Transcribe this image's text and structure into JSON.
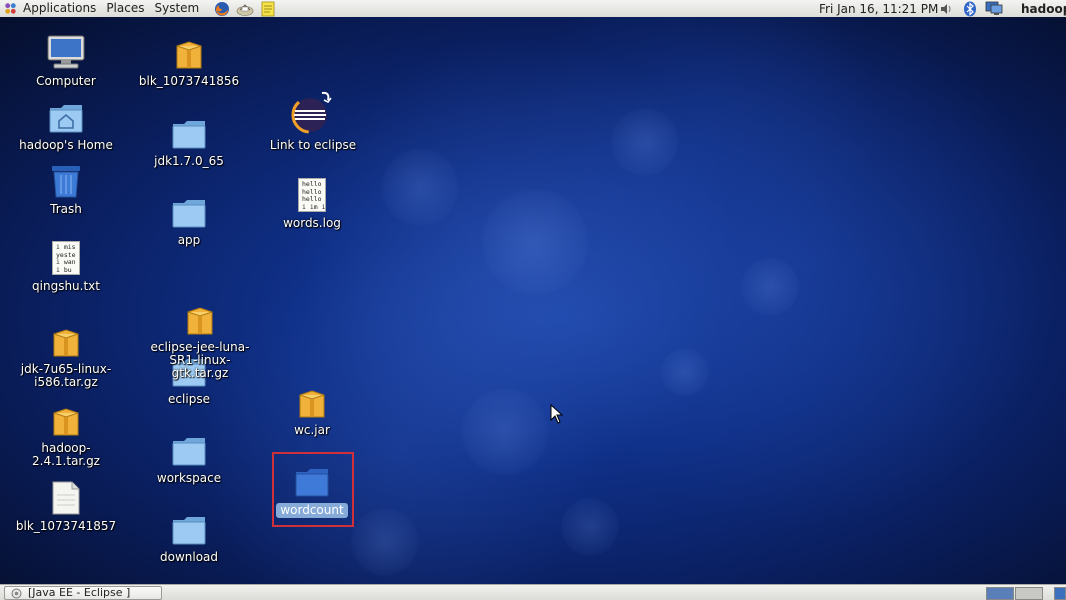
{
  "top_panel": {
    "menus": [
      "Applications",
      "Places",
      "System"
    ],
    "launchers": [
      "firefox-icon",
      "mail-client-icon",
      "notes-icon"
    ],
    "datetime": "Fri Jan 16, 11:21 PM",
    "username": "hadoop"
  },
  "desktop": {
    "icons": {
      "computer": "Computer",
      "home": "hadoop's Home",
      "trash": "Trash",
      "qingshu": "qingshu.txt",
      "qingshu_preview": "i mis\nyeste\ni wan\ni bu",
      "jdk_tar": "jdk-7u65-linux-i586.tar.gz",
      "hadoop_tar": "hadoop-2.4.1.tar.gz",
      "blk_857": "blk_1073741857",
      "blk_856": "blk_1073741856",
      "jdk_dir": "jdk1.7.0_65",
      "app": "app",
      "eclipse_tar": "eclipse-jee-luna-SR1-linux-gtk.tar.gz",
      "eclipse_dir": "eclipse",
      "workspace": "workspace",
      "download": "download",
      "eclipse_link": "Link to eclipse",
      "words_log": "words.log",
      "words_preview": "hello\nhello\nhello\ni im i",
      "wc_jar": "wc.jar",
      "wordcount": "wordcount"
    }
  },
  "bottom_panel": {
    "task": "[Java EE - Eclipse ]"
  },
  "colors": {
    "panel_bg": "#e8e8e6",
    "desktop_bg": "#0f2f86",
    "folder": "#8ec2f0",
    "archive": "#f0b23a",
    "highlight": "#d0303a",
    "selection": "#86abd9"
  }
}
